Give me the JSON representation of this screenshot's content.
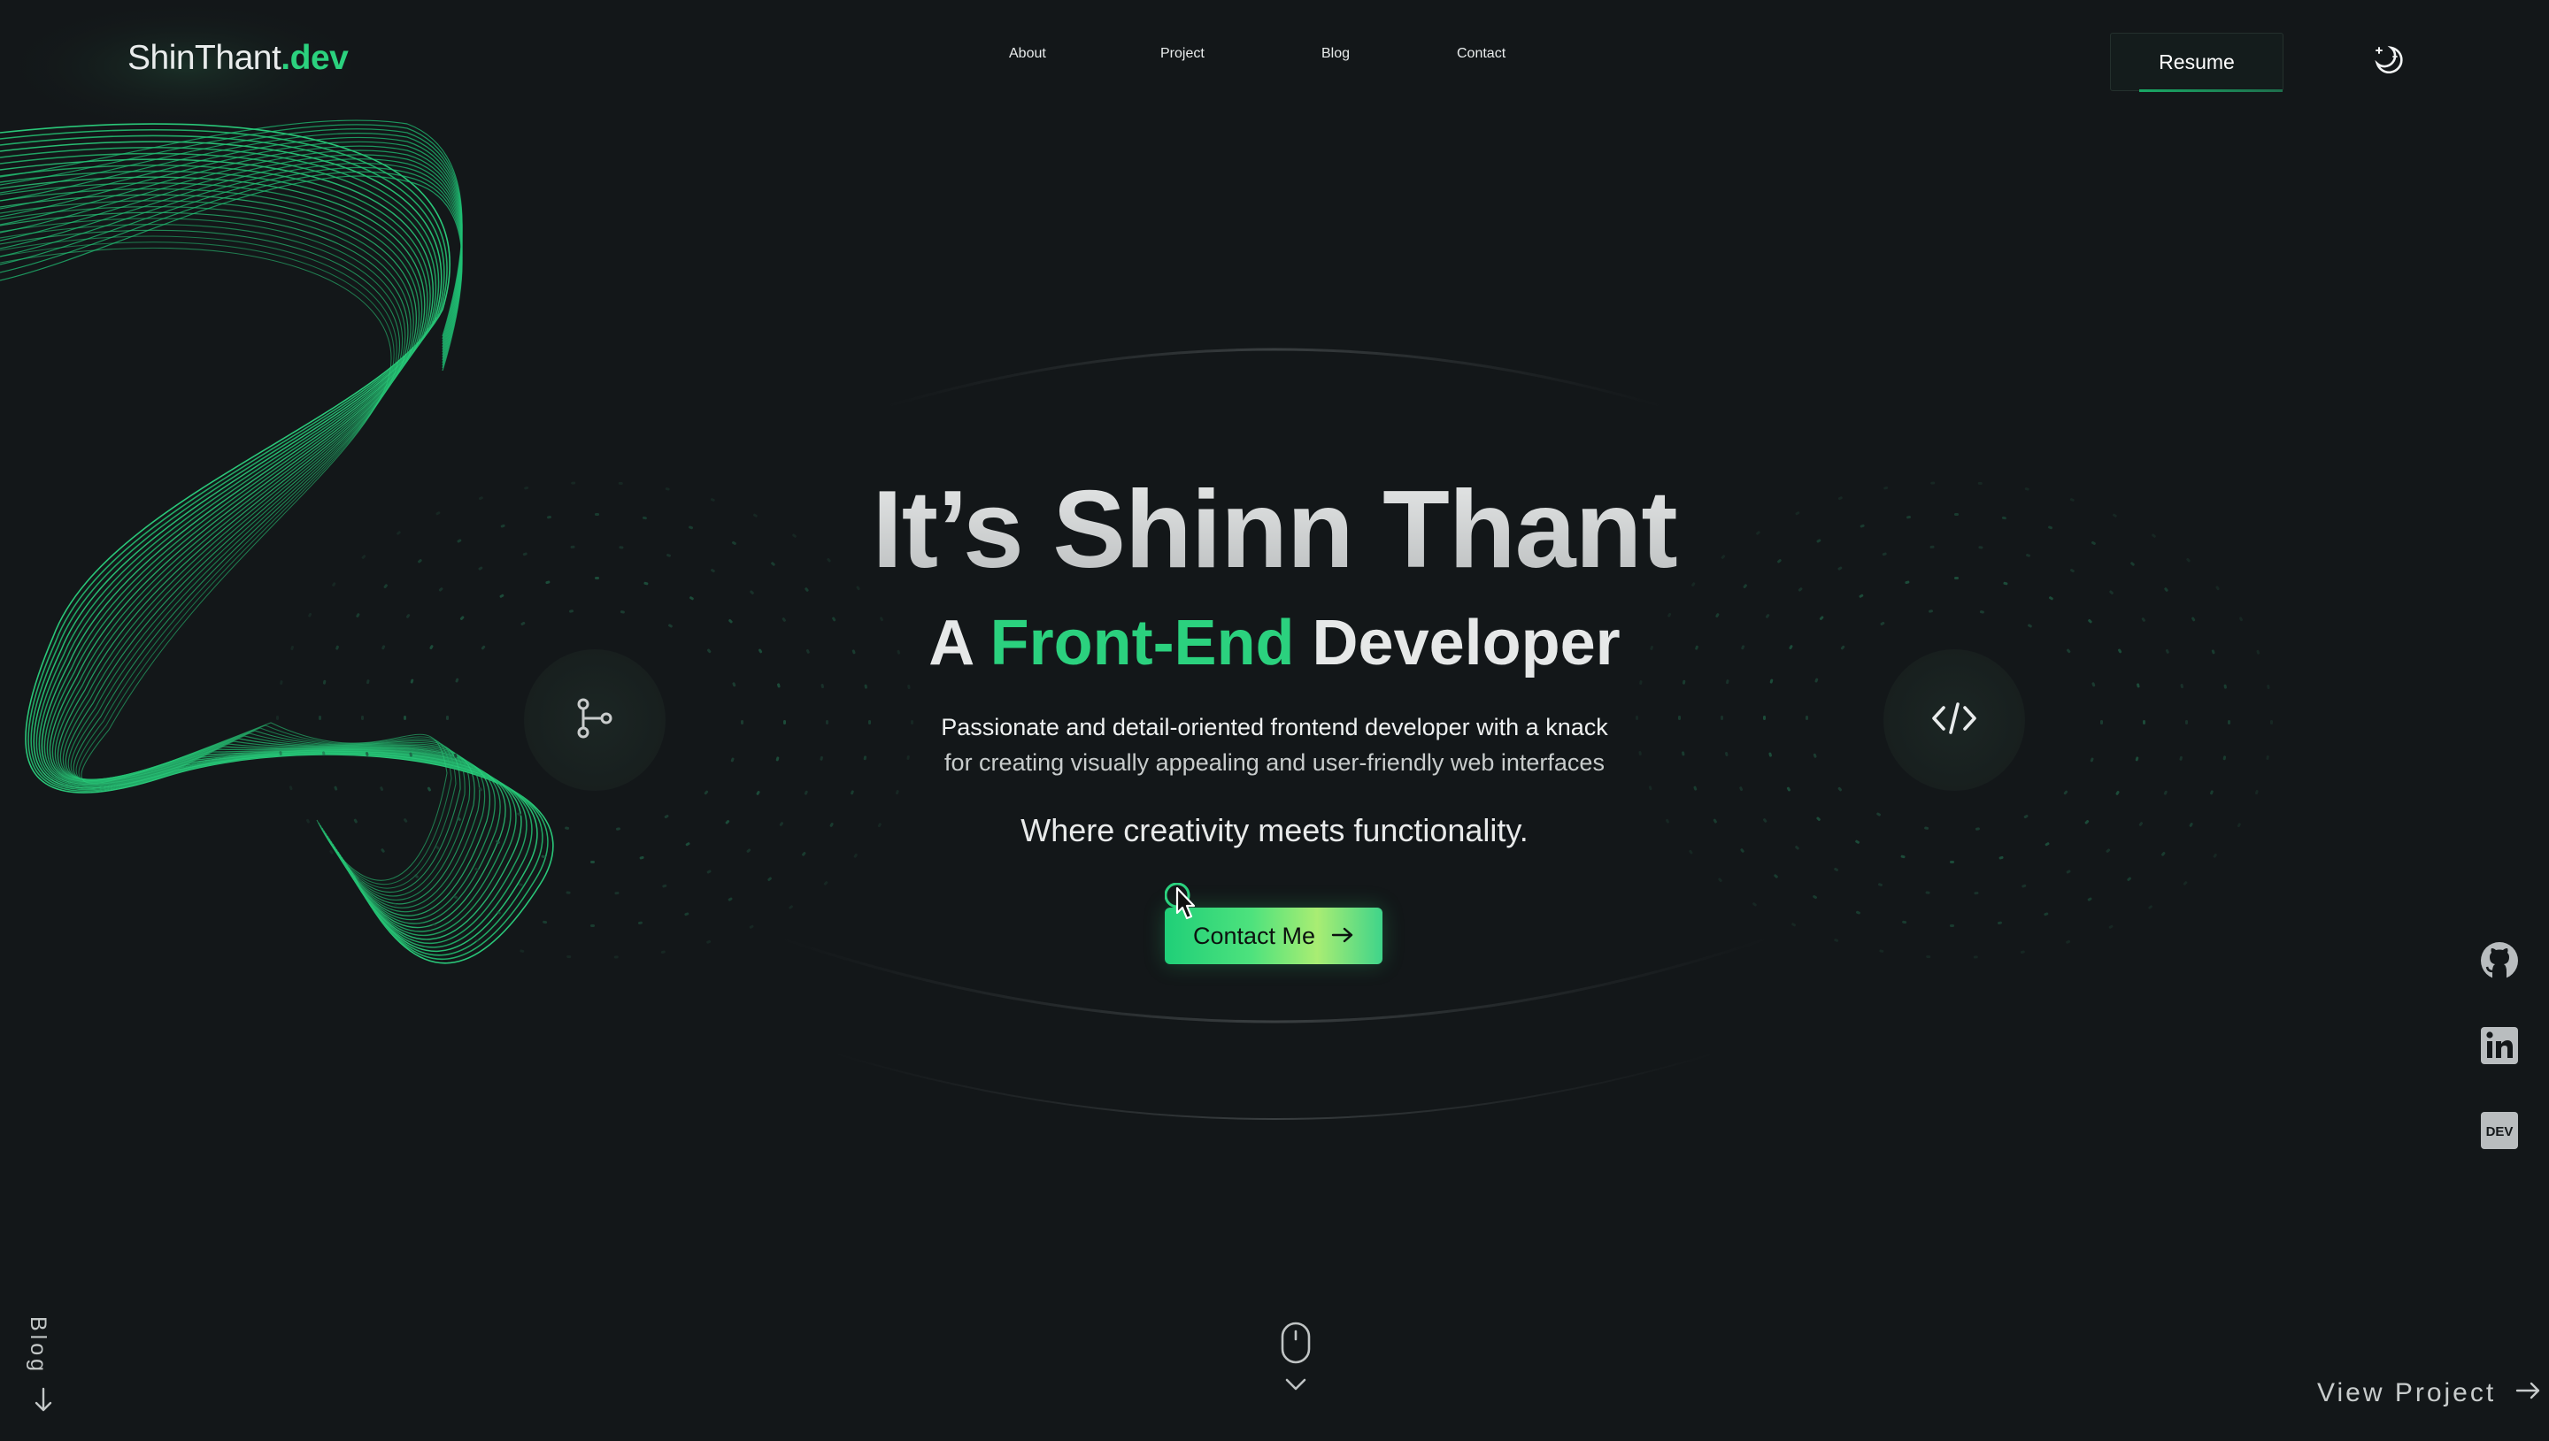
{
  "header": {
    "logo_main": "ShinThant",
    "logo_accent": ".dev",
    "nav": [
      {
        "label": "About"
      },
      {
        "label": "Project"
      },
      {
        "label": "Blog"
      },
      {
        "label": "Contact"
      }
    ],
    "resume_label": "Resume",
    "theme_toggle_icon": "moon-stars-icon"
  },
  "hero": {
    "title": "It’s Shinn Thant",
    "subtitle_prefix": "A ",
    "subtitle_highlight": "Front-End",
    "subtitle_suffix": " Developer",
    "description_line1": "Passionate and detail-oriented frontend developer with a knack",
    "description_line2": "for creating visually appealing and user-friendly web interfaces",
    "tagline": "Where creativity meets functionality.",
    "cta_label": "Contact Me",
    "cta_icon": "arrow-right-icon",
    "left_badge_icon": "git-branch-icon",
    "right_badge_icon": "code-icon"
  },
  "social": [
    {
      "name": "github-icon"
    },
    {
      "name": "linkedin-icon"
    },
    {
      "name": "dev-to-icon",
      "label": "DEV"
    }
  ],
  "footer": {
    "blog_label": "Blog",
    "view_project_label": "View Project",
    "scroll_icon": "mouse-scroll-icon"
  },
  "colors": {
    "background": "#131719",
    "accent": "#2bd17e",
    "text": "#e9ecec"
  }
}
